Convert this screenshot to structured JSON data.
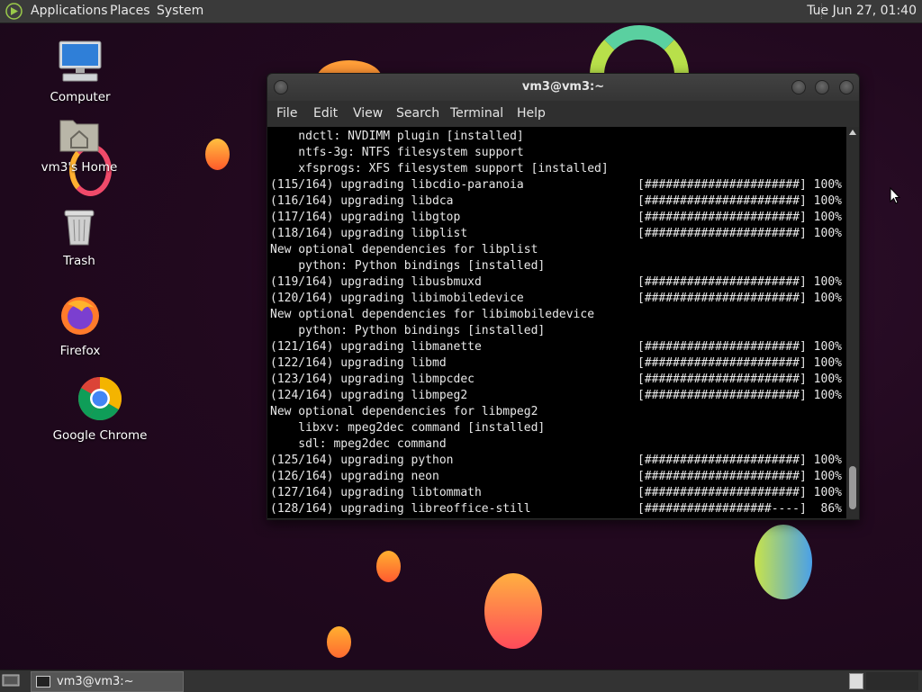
{
  "top_panel": {
    "menus": [
      "Applications",
      "Places",
      "System"
    ],
    "clock": "Tue Jun 27, 01:40"
  },
  "desktop_icons": [
    {
      "label": "Computer"
    },
    {
      "label": "vm3's Home"
    },
    {
      "label": "Trash"
    },
    {
      "label": "Firefox"
    },
    {
      "label": "Google Chrome"
    }
  ],
  "terminal": {
    "title": "vm3@vm3:~",
    "menu": [
      "File",
      "Edit",
      "Search",
      "Terminal",
      "Help",
      "View"
    ],
    "lines": [
      {
        "text": "    ndctl: NVDIMM plugin [installed]"
      },
      {
        "text": "    ntfs-3g: NTFS filesystem support"
      },
      {
        "text": "    xfsprogs: XFS filesystem support [installed]"
      },
      {
        "text": "(115/164) upgrading libcdio-paranoia",
        "bar": "[######################] 100%"
      },
      {
        "text": "(116/164) upgrading libdca",
        "bar": "[######################] 100%"
      },
      {
        "text": "(117/164) upgrading libgtop",
        "bar": "[######################] 100%"
      },
      {
        "text": "(118/164) upgrading libplist",
        "bar": "[######################] 100%"
      },
      {
        "text": "New optional dependencies for libplist"
      },
      {
        "text": "    python: Python bindings [installed]"
      },
      {
        "text": "(119/164) upgrading libusbmuxd",
        "bar": "[######################] 100%"
      },
      {
        "text": "(120/164) upgrading libimobiledevice",
        "bar": "[######################] 100%"
      },
      {
        "text": "New optional dependencies for libimobiledevice"
      },
      {
        "text": "    python: Python bindings [installed]"
      },
      {
        "text": "(121/164) upgrading libmanette",
        "bar": "[######################] 100%"
      },
      {
        "text": "(122/164) upgrading libmd",
        "bar": "[######################] 100%"
      },
      {
        "text": "(123/164) upgrading libmpcdec",
        "bar": "[######################] 100%"
      },
      {
        "text": "(124/164) upgrading libmpeg2",
        "bar": "[######################] 100%"
      },
      {
        "text": "New optional dependencies for libmpeg2"
      },
      {
        "text": "    libxv: mpeg2dec command [installed]"
      },
      {
        "text": "    sdl: mpeg2dec command"
      },
      {
        "text": "(125/164) upgrading python",
        "bar": "[######################] 100%"
      },
      {
        "text": "(126/164) upgrading neon",
        "bar": "[######################] 100%"
      },
      {
        "text": "(127/164) upgrading libtommath",
        "bar": "[######################] 100%"
      },
      {
        "text": "(128/164) upgrading libreoffice-still",
        "bar": "[##################----]  86%"
      }
    ]
  },
  "taskbar": {
    "items": [
      {
        "label": "vm3@vm3:~"
      }
    ]
  },
  "colors": {
    "panel": "#3a3a3a",
    "desktop": "#22091f",
    "terminal_bg": "#000000"
  }
}
